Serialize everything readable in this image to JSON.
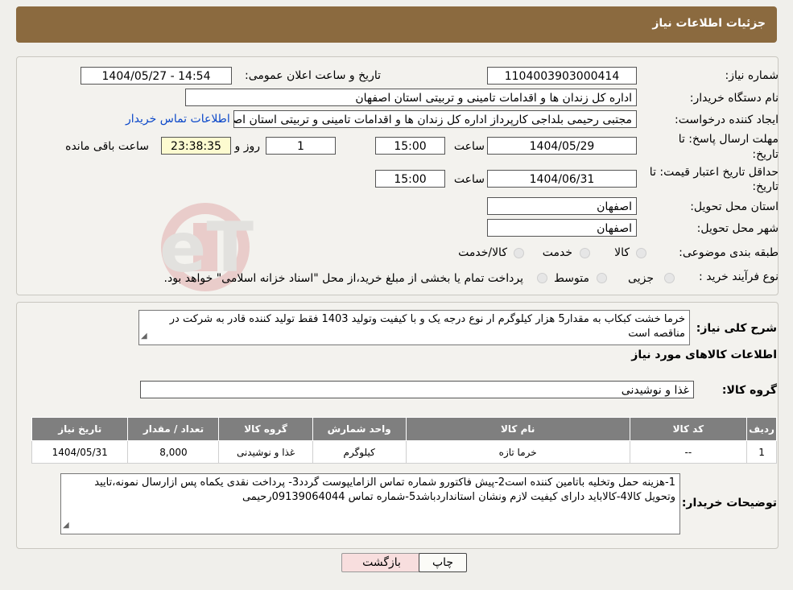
{
  "header": {
    "title": "جزئیات اطلاعات نیاز"
  },
  "watermark": {
    "text": "AriaTender.neT"
  },
  "form": {
    "need_number_label": "شماره نیاز:",
    "need_number": "1104003903000414",
    "announce_label": "تاریخ و ساعت اعلان عمومی:",
    "announce_value": "1404/05/27 - 14:54",
    "buyer_label": "نام دستگاه خریدار:",
    "buyer_value": "اداره کل زندان ها و اقدامات تامینی و تربیتی استان اصفهان",
    "creator_label": "ایجاد کننده درخواست:",
    "creator_value": "مجتبی رحیمی بلداجی کارپرداز اداره کل زندان ها و اقدامات تامینی و تربیتی استان اصفهان",
    "contact_link": "اطلاعات تماس خریدار",
    "deadline_label_1": "مهلت ارسال پاسخ: تا",
    "deadline_label_2": "تاریخ:",
    "deadline_date": "1404/05/29",
    "time_label": "ساعت",
    "deadline_time": "15:00",
    "days_value": "1",
    "days_label": "روز و",
    "remaining_value": "23:38:35",
    "remaining_label": "ساعت باقی مانده",
    "validity_label_1": "حداقل تاریخ اعتبار قیمت: تا",
    "validity_label_2": "تاریخ:",
    "validity_date": "1404/06/31",
    "validity_time": "15:00",
    "province_label": "استان محل تحویل:",
    "province_value": "اصفهان",
    "city_label": "شهر محل تحویل:",
    "city_value": "اصفهان",
    "category_label": "طبقه بندی موضوعی:",
    "category_options": [
      "کالا",
      "خدمت",
      "کالا/خدمت"
    ],
    "process_label": "نوع فرآیند خرید :",
    "process_options": [
      "جزیی",
      "متوسط"
    ],
    "process_note": "پرداخت تمام یا بخشی از مبلغ خرید،از محل \"اسناد خزانه اسلامی\" خواهد بود."
  },
  "details": {
    "summary_label": "شرح کلی نیاز:",
    "summary_value": "خرما خشت کبکاب به مقدار5 هزار کیلوگرم  ار نوع درجه یک و با کیفیت وتولید 1403 فقط تولید کننده قادر به شرکت در مناقصه است",
    "goods_info_title": "اطلاعات کالاهای مورد نیاز",
    "goods_group_label": "گروه کالا:",
    "goods_group_value": "غذا و نوشیدنی",
    "table": {
      "headers": [
        "ردیف",
        "کد کالا",
        "نام کالا",
        "واحد شمارش",
        "گروه کالا",
        "تعداد / مقدار",
        "تاریخ نیاز"
      ],
      "rows": [
        [
          "1",
          "--",
          "خرما تازه",
          "کیلوگرم",
          "غذا و نوشیدنی",
          "8,000",
          "1404/05/31"
        ]
      ]
    },
    "buyer_notes_label": "توضیحات خریدار:",
    "buyer_notes_value": "1-هزینه حمل وتخلیه باتامین کننده است2-پیش فاکتورو شماره تماس الزامایپوست گردد3- پرداخت نقدی یکماه  پس ازارسال نمونه،تایید وتحویل کالا4-کالاباید دارای کیفیت لازم ونشان استانداردباشد5-شماره تماس 09139064044رحیمی"
  },
  "buttons": {
    "back": "بازگشت",
    "print": "چاپ"
  },
  "colors": {
    "header_bg": "#8b6a3f",
    "link": "#0a47c9",
    "table_header_bg": "#7f7f7f",
    "back_button_bg": "#f8dede"
  }
}
